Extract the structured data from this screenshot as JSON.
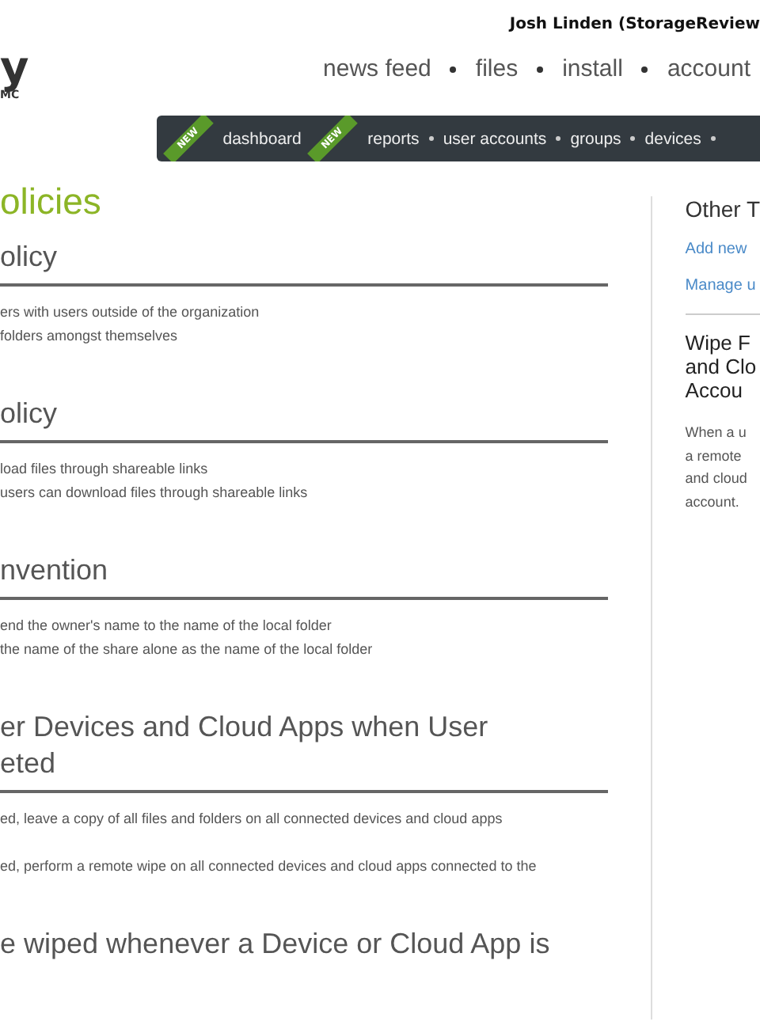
{
  "header": {
    "user": "Josh Linden (StorageReview",
    "logo": {
      "mark": "y",
      "sub": "MC"
    },
    "nav": [
      "news feed",
      "files",
      "install",
      "account"
    ]
  },
  "subnav": [
    {
      "label": "dashboard",
      "badge": "NEW"
    },
    {
      "label": "reports",
      "badge": "NEW"
    },
    {
      "label": "user accounts"
    },
    {
      "label": "groups"
    },
    {
      "label": "devices"
    }
  ],
  "page_title": "olicies",
  "sections": [
    {
      "heading": [
        "olicy"
      ],
      "lines": [
        "ers with users outside of the organization",
        "folders amongst themselves"
      ]
    },
    {
      "heading": [
        "olicy"
      ],
      "lines": [
        "load files through shareable links",
        "users can download files through shareable links"
      ]
    },
    {
      "heading": [
        "nvention"
      ],
      "lines": [
        "end the owner's name to the name of the local folder",
        "the name of the share alone as the name of the local folder"
      ]
    },
    {
      "heading": [
        "er Devices and Cloud Apps when User",
        "eted"
      ],
      "lines": [
        "ed, leave a copy of all files and folders on all connected devices and cloud apps",
        "ed, perform a remote wipe on all connected devices and cloud apps connected to the"
      ]
    },
    {
      "heading": [
        "e wiped whenever a Device or Cloud App is"
      ]
    }
  ],
  "sidebar": {
    "title": "Other T",
    "links": [
      "Add new",
      "Manage u"
    ],
    "info_heading": [
      "Wipe F",
      "and Clo",
      "Accou"
    ],
    "info_text": [
      "When a u",
      "a remote",
      "and cloud",
      "account."
    ]
  }
}
